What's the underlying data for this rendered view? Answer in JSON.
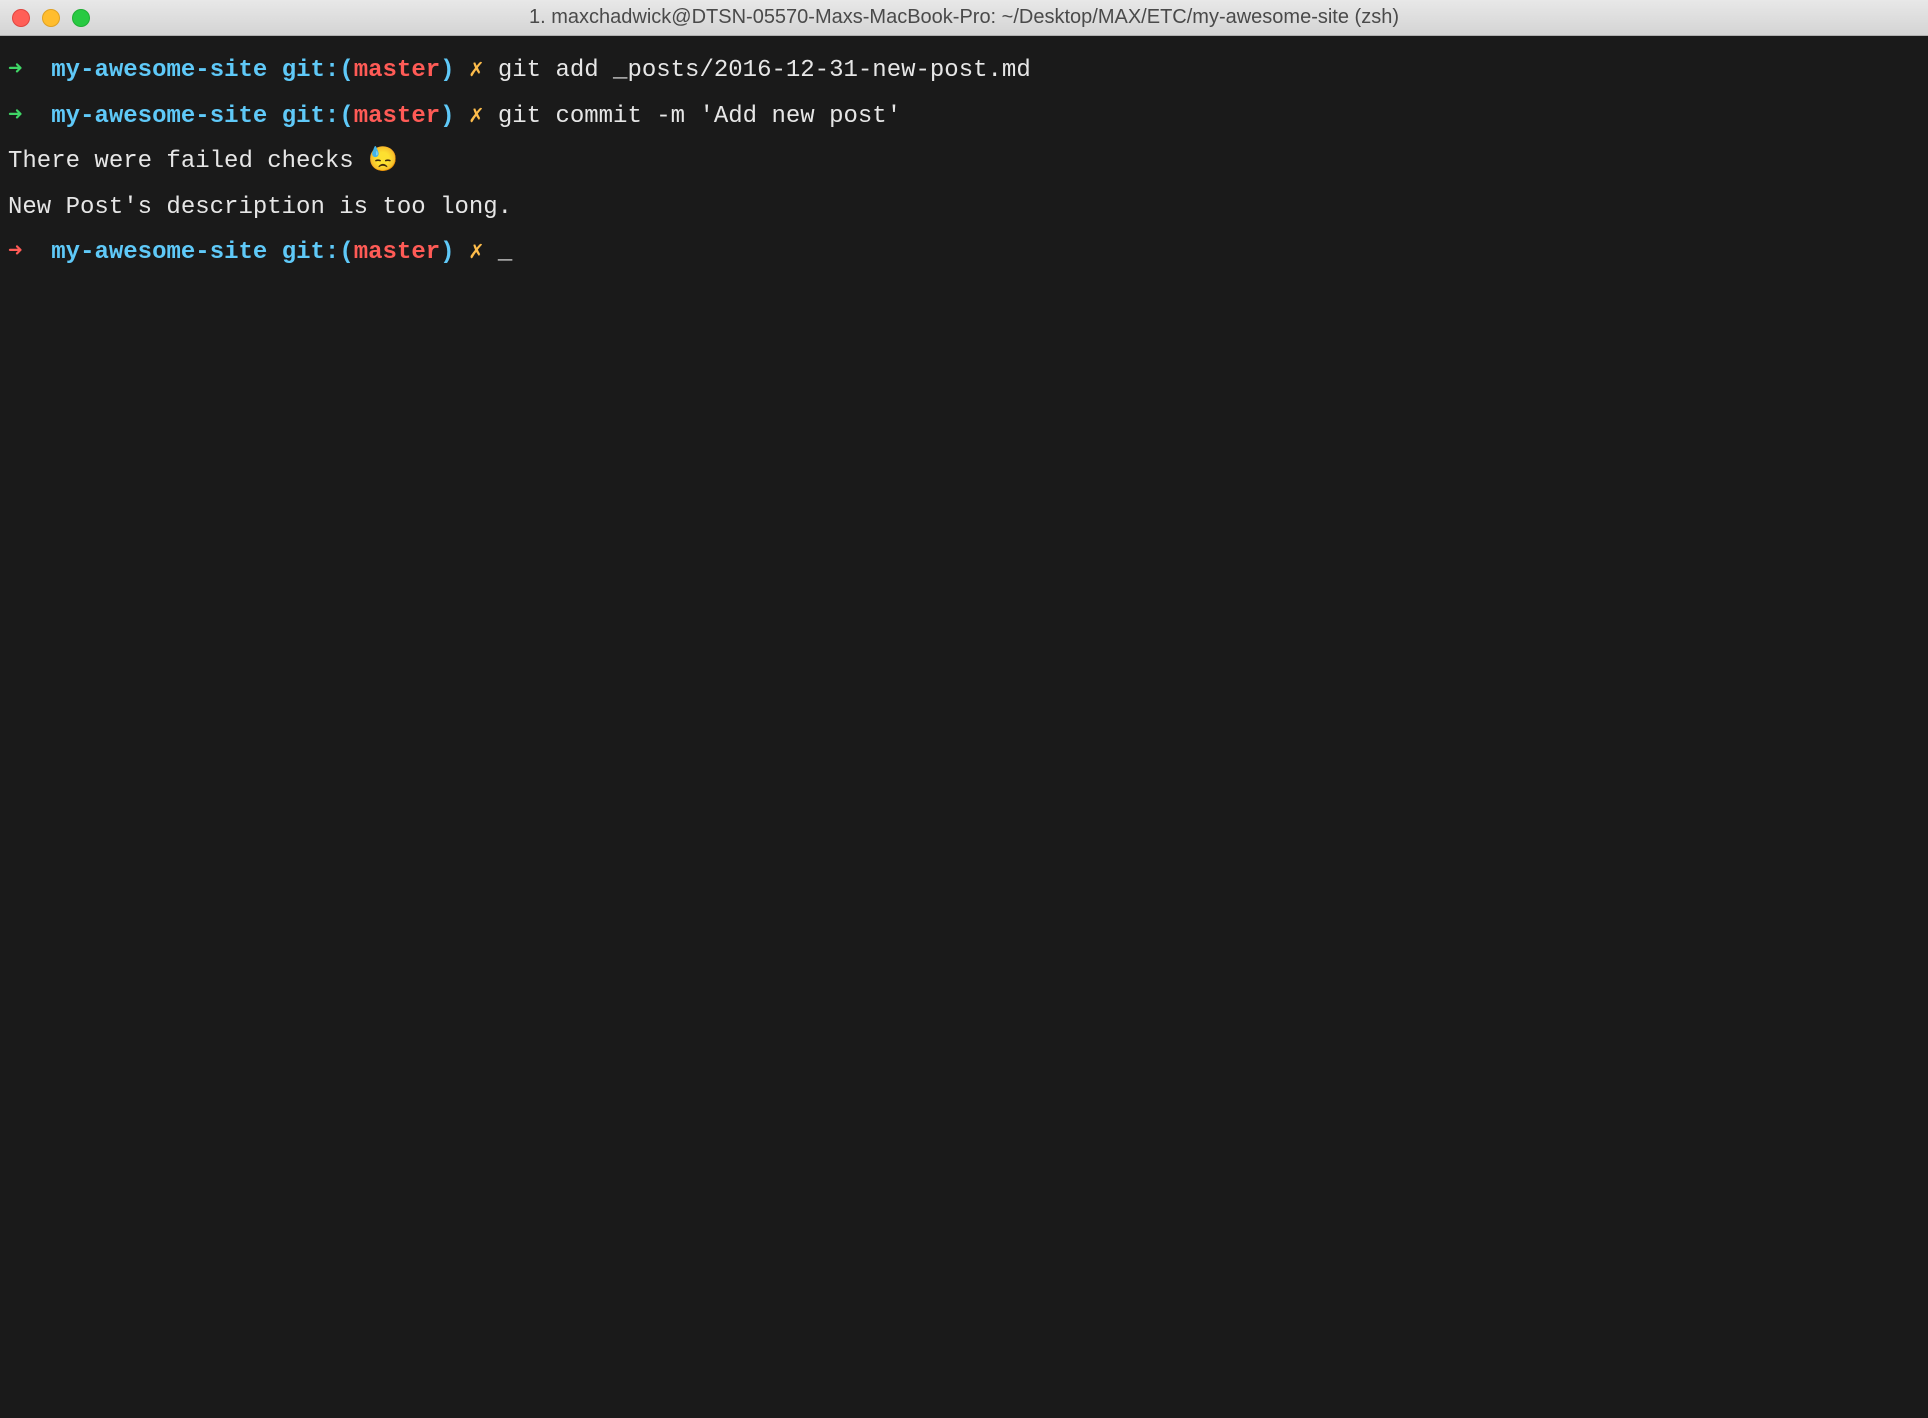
{
  "window": {
    "title": "1. maxchadwick@DTSN-05570-Maxs-MacBook-Pro: ~/Desktop/MAX/ETC/my-awesome-site (zsh)"
  },
  "prompt": {
    "arrow": "➜",
    "dir": "my-awesome-site",
    "git_label": "git:",
    "paren_open": "(",
    "branch": "master",
    "paren_close": ")",
    "dirty": "✗"
  },
  "lines": {
    "cmd1": "git add _posts/2016-12-31-new-post.md",
    "cmd2": "git commit -m 'Add new post'",
    "out1": "There were failed checks 😓",
    "out2": "New Post's description is too long.",
    "cursor": "_"
  }
}
